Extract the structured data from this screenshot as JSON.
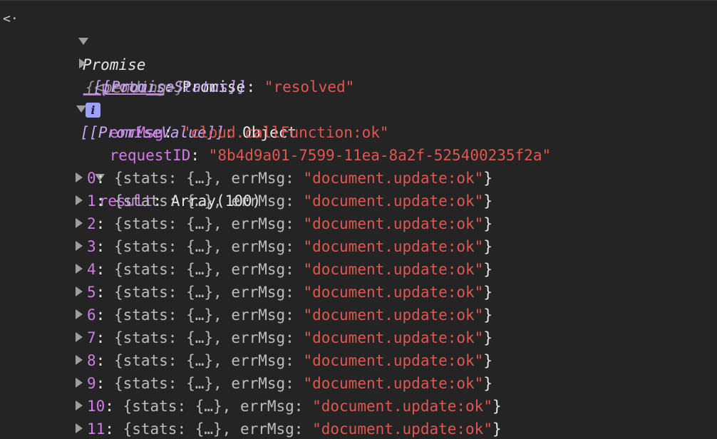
{
  "prompt_glyph": "<·",
  "root": {
    "label": "Promise",
    "state": "{<pending>}",
    "info": "i"
  },
  "proto": {
    "key": "__proto__",
    "sep": ": ",
    "value": "Promise"
  },
  "status": {
    "key": "[[PromiseStatus]]",
    "sep": ": ",
    "value": "\"resolved\""
  },
  "promise_value": {
    "key": "[[PromiseValue]]",
    "sep": ": ",
    "value": "Object"
  },
  "err_msg": {
    "key": "errMsg",
    "sep": ": ",
    "value": "\"cloud.callFunction:ok\""
  },
  "request_id": {
    "key": "requestID",
    "sep": ": ",
    "value": "\"8b4d9a01-7599-11ea-8a2f-525400235f2a\""
  },
  "result": {
    "key": "result",
    "sep": ": ",
    "value": "Array(100)"
  },
  "items": [
    {
      "index": "0",
      "body": "{stats: {…}, errMsg: ",
      "msg": "\"document.update:ok\"",
      "close": "}"
    },
    {
      "index": "1",
      "body": "{stats: {…}, errMsg: ",
      "msg": "\"document.update:ok\"",
      "close": "}"
    },
    {
      "index": "2",
      "body": "{stats: {…}, errMsg: ",
      "msg": "\"document.update:ok\"",
      "close": "}"
    },
    {
      "index": "3",
      "body": "{stats: {…}, errMsg: ",
      "msg": "\"document.update:ok\"",
      "close": "}"
    },
    {
      "index": "4",
      "body": "{stats: {…}, errMsg: ",
      "msg": "\"document.update:ok\"",
      "close": "}"
    },
    {
      "index": "5",
      "body": "{stats: {…}, errMsg: ",
      "msg": "\"document.update:ok\"",
      "close": "}"
    },
    {
      "index": "6",
      "body": "{stats: {…}, errMsg: ",
      "msg": "\"document.update:ok\"",
      "close": "}"
    },
    {
      "index": "7",
      "body": "{stats: {…}, errMsg: ",
      "msg": "\"document.update:ok\"",
      "close": "}"
    },
    {
      "index": "8",
      "body": "{stats: {…}, errMsg: ",
      "msg": "\"document.update:ok\"",
      "close": "}"
    },
    {
      "index": "9",
      "body": "{stats: {…}, errMsg: ",
      "msg": "\"document.update:ok\"",
      "close": "}"
    },
    {
      "index": "10",
      "body": "{stats: {…}, errMsg: ",
      "msg": "\"document.update:ok\"",
      "close": "}"
    },
    {
      "index": "11",
      "body": "{stats: {…}, errMsg: ",
      "msg": "\"document.update:ok\"",
      "close": "}"
    }
  ],
  "colors": {
    "background": "#242424",
    "key_purple": "#d27be9",
    "internal_key": "#c9a6f5",
    "string_red": "#e0574f",
    "text": "#e8e8e8",
    "badge": "#9ea2f2"
  }
}
